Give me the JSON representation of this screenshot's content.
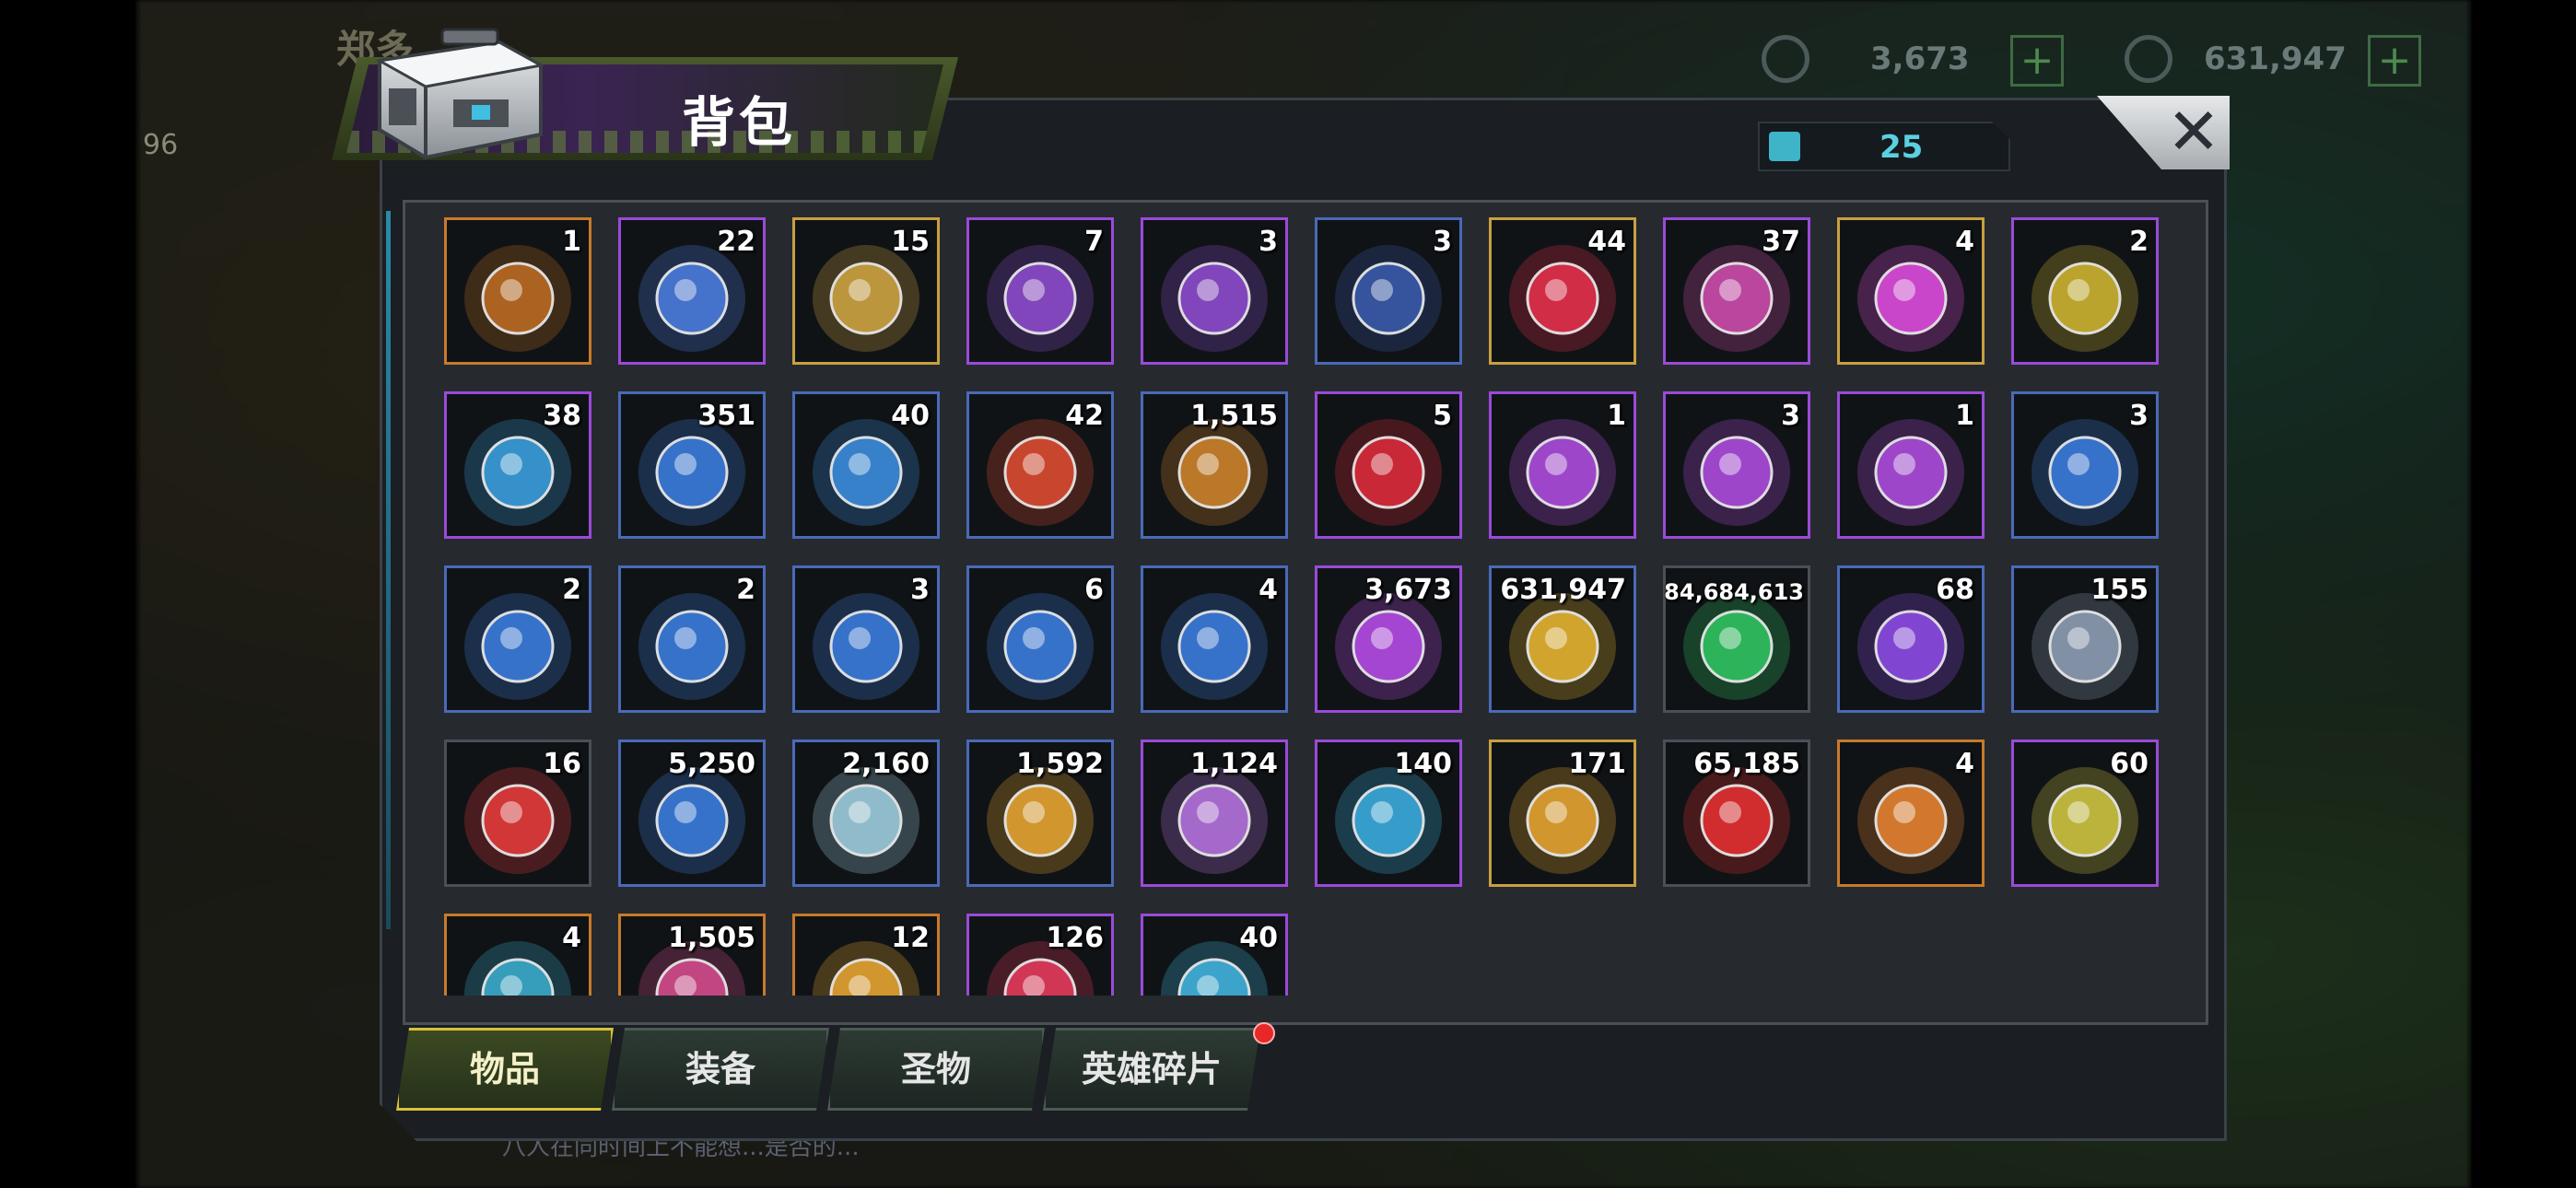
{
  "hud": {
    "player_name": "郑多",
    "level": "96",
    "res1_value": "3,673",
    "res2_value": "631,947",
    "plus": "+",
    "chat": "八人在同时间上不能想...是否的..."
  },
  "panel": {
    "title": "背包",
    "capacity": "25",
    "close": "✕"
  },
  "items": [
    {
      "qty": "1",
      "icon": "treasure-chest",
      "color": "#b86a22",
      "rarity": "#c87a2a"
    },
    {
      "qty": "22",
      "icon": "cosmic-potion",
      "color": "#4a7ad8",
      "rarity": "#9a4ad8"
    },
    {
      "qty": "15",
      "icon": "speedup-24h",
      "color": "#c8a040",
      "rarity": "#c8a040"
    },
    {
      "qty": "7",
      "icon": "speedup-12h-cyan",
      "color": "#8a4ac8",
      "rarity": "#9a4ad8"
    },
    {
      "qty": "3",
      "icon": "speedup-12h-gold",
      "color": "#8a4ac8",
      "rarity": "#9a4ad8"
    },
    {
      "qty": "3",
      "icon": "speedup-4h",
      "color": "#3a5aa8",
      "rarity": "#4a6ab8"
    },
    {
      "qty": "44",
      "icon": "red-bottlecap",
      "color": "#e0304a",
      "rarity": "#c8a040"
    },
    {
      "qty": "37",
      "icon": "film-reel",
      "color": "#c84aa8",
      "rarity": "#9a4ad8"
    },
    {
      "qty": "4",
      "icon": "purple-bottlecap",
      "color": "#d84ad8",
      "rarity": "#c8a040"
    },
    {
      "qty": "2",
      "icon": "poker-chip",
      "color": "#c8b030",
      "rarity": "#9a4ad8"
    },
    {
      "qty": "38",
      "icon": "police-badge",
      "color": "#3a9ad8",
      "rarity": "#9a4ad8"
    },
    {
      "qty": "351",
      "icon": "cinema-ticket",
      "color": "#3a7ad8",
      "rarity": "#4a6ab8"
    },
    {
      "qty": "40",
      "icon": "blue-bottlecap",
      "color": "#3a8ad8",
      "rarity": "#4a6ab8"
    },
    {
      "qty": "42",
      "icon": "red-poker-chip",
      "color": "#d84a30",
      "rarity": "#4a6ab8"
    },
    {
      "qty": "1,515",
      "icon": "bullet",
      "color": "#c8802a",
      "rarity": "#4a6ab8"
    },
    {
      "qty": "5",
      "icon": "christmas-ornament",
      "color": "#d82a3a",
      "rarity": "#9a4ad8"
    },
    {
      "qty": "1",
      "icon": "blueprint-boots-purple",
      "color": "#a84ad8",
      "rarity": "#9a4ad8"
    },
    {
      "qty": "3",
      "icon": "blueprint-shirt-purple",
      "color": "#a84ad8",
      "rarity": "#9a4ad8"
    },
    {
      "qty": "1",
      "icon": "blueprint-gun-purple",
      "color": "#a84ad8",
      "rarity": "#9a4ad8"
    },
    {
      "qty": "3",
      "icon": "blueprint-hat-blue",
      "color": "#3a7ad8",
      "rarity": "#4a6ab8"
    },
    {
      "qty": "2",
      "icon": "blueprint-gun-blue",
      "color": "#3a7ad8",
      "rarity": "#4a6ab8"
    },
    {
      "qty": "2",
      "icon": "blueprint-necklace-blue",
      "color": "#3a7ad8",
      "rarity": "#4a6ab8"
    },
    {
      "qty": "3",
      "icon": "blueprint-boots-blue",
      "color": "#3a7ad8",
      "rarity": "#4a6ab8"
    },
    {
      "qty": "6",
      "icon": "blueprint-knives-blue",
      "color": "#3a7ad8",
      "rarity": "#4a6ab8"
    },
    {
      "qty": "4",
      "icon": "blueprint-shirt-blue",
      "color": "#3a7ad8",
      "rarity": "#4a6ab8"
    },
    {
      "qty": "3,673",
      "icon": "purple-gem",
      "color": "#b04ae0",
      "rarity": "#9a4ad8"
    },
    {
      "qty": "631,947",
      "icon": "gold-coins",
      "color": "#e0b030",
      "rarity": "#4a6ab8"
    },
    {
      "qty": "84,684,613",
      "icon": "green-canister",
      "color": "#30c060",
      "rarity": "#4a5058"
    },
    {
      "qty": "68",
      "icon": "purple-orb",
      "color": "#8a4ae0",
      "rarity": "#4a6ab8"
    },
    {
      "qty": "155",
      "icon": "gear",
      "color": "#8a9ab0",
      "rarity": "#4a6ab8"
    },
    {
      "qty": "16",
      "icon": "red-token",
      "color": "#e03a3a",
      "rarity": "#4a5058"
    },
    {
      "qty": "5,250",
      "icon": "eye-relic",
      "color": "#3a7ad8",
      "rarity": "#4a6ab8"
    },
    {
      "qty": "2,160",
      "icon": "crystal-prism",
      "color": "#9ac8d8",
      "rarity": "#4a6ab8"
    },
    {
      "qty": "1,592",
      "icon": "fist-emblem",
      "color": "#e0a030",
      "rarity": "#4a6ab8"
    },
    {
      "qty": "1,124",
      "icon": "puzzle-piece",
      "color": "#b070d8",
      "rarity": "#9a4ad8"
    },
    {
      "qty": "140",
      "icon": "blue-chip-badge",
      "color": "#3aa8d8",
      "rarity": "#9a4ad8"
    },
    {
      "qty": "171",
      "icon": "gold-chip-badge",
      "color": "#e0a030",
      "rarity": "#c8a040"
    },
    {
      "qty": "65,185",
      "icon": "red-hex-token",
      "color": "#e03030",
      "rarity": "#4a5058"
    },
    {
      "qty": "4",
      "icon": "star-crystal",
      "color": "#e08030",
      "rarity": "#c87a2a"
    },
    {
      "qty": "60",
      "icon": "lightning-coin",
      "color": "#c8c040",
      "rarity": "#9a4ad8"
    },
    {
      "qty": "4",
      "icon": "propeller-emblem",
      "color": "#3aa8c8",
      "rarity": "#c87a2a"
    },
    {
      "qty": "1,505",
      "icon": "rose-box",
      "color": "#d04a8a",
      "rarity": "#c87a2a"
    },
    {
      "qty": "12",
      "icon": "golden-shield",
      "color": "#e0a030",
      "rarity": "#c87a2a"
    },
    {
      "qty": "126",
      "icon": "red-target",
      "color": "#e03a5a",
      "rarity": "#9a4ad8"
    },
    {
      "qty": "40",
      "icon": "dna-helix",
      "color": "#40b0d8",
      "rarity": "#9a4ad8"
    }
  ],
  "tabs": [
    {
      "label": "物品",
      "active": true
    },
    {
      "label": "装备",
      "active": false
    },
    {
      "label": "圣物",
      "active": false
    },
    {
      "label": "英雄碎片",
      "active": false
    }
  ],
  "colors": {
    "active_tab_border": "#d8c23a",
    "capacity_text": "#5ad0e0",
    "notification_dot": "#e62828"
  }
}
